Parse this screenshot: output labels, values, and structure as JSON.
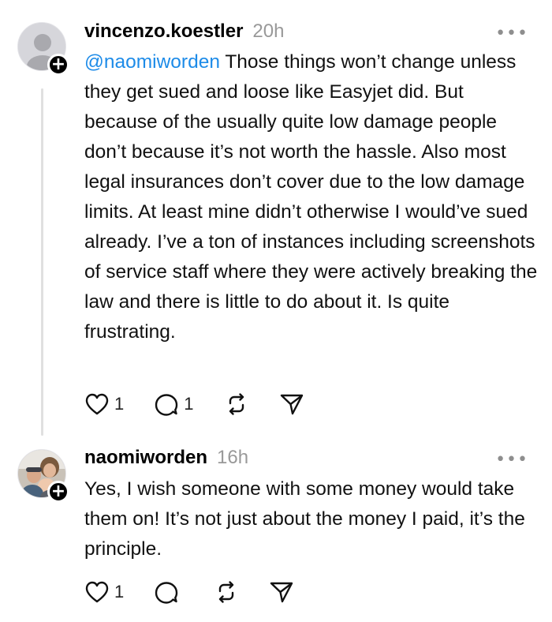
{
  "posts": [
    {
      "username": "vincenzo.koestler",
      "time": "20h",
      "more": "•••",
      "avatar": "default-user-icon",
      "mention": "@naomiworden",
      "text": " Those things won’t change unless they get sued and loose like Easyjet did. But because of the usually quite low damage people don’t because it’s not worth the hassle. Also most legal insurances don’t cover due to the low damage limits. At least mine didn’t otherwise I would’ve sued already. I’ve a ton of instances including screenshots of service staff where they were actively breaking the law and there is little to do about it. Is quite frustrating.",
      "likes": "1",
      "replies": "1"
    },
    {
      "username": "naomiworden",
      "time": "16h",
      "more": "•••",
      "avatar": "profile-photo",
      "text": "Yes, I wish someone with some money would take them on! It’s not just about the money I paid, it’s the principle.",
      "likes": "1",
      "replies": ""
    }
  ],
  "follow_badge": "+",
  "colors": {
    "mention": "#1d8be8",
    "time": "#999999",
    "thread_line": "#e0e0e0"
  }
}
